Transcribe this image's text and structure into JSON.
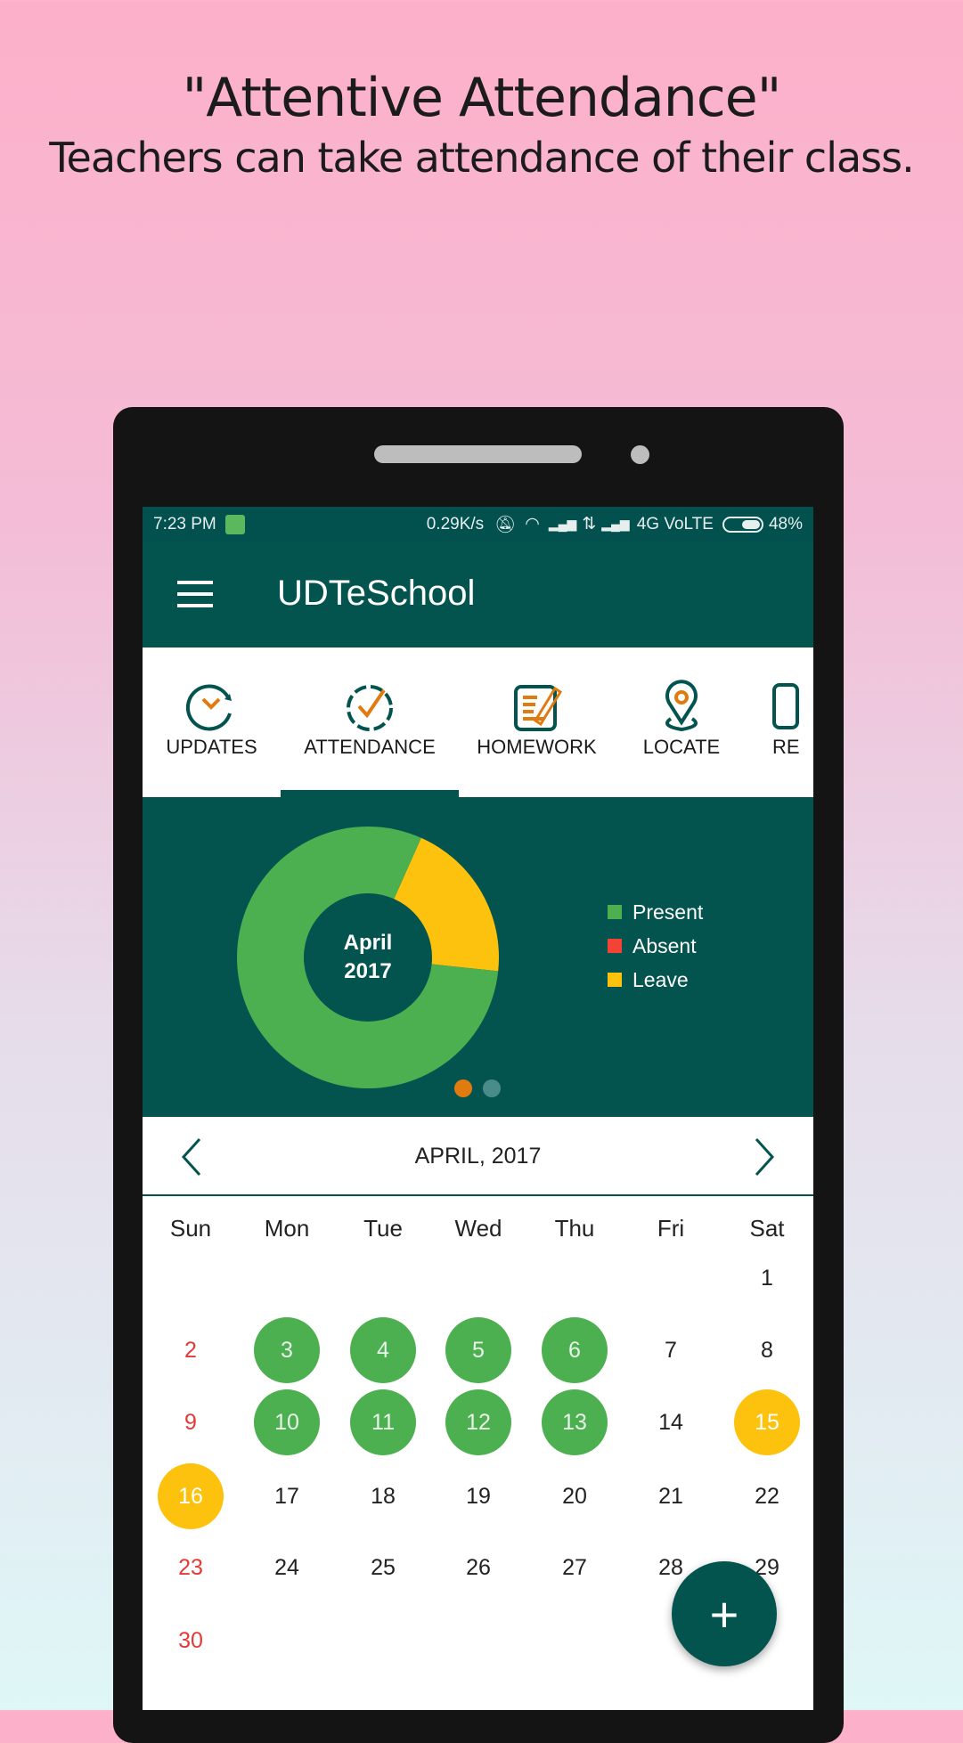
{
  "promo": {
    "headline": "\"Attentive Attendance\"",
    "subline": "Teachers can take attendance of their class."
  },
  "status_bar": {
    "time": "7:23 PM",
    "speed": "0.29K/s",
    "network": "4G VoLTE",
    "battery": "48%",
    "battery_level": 0.48
  },
  "app_bar": {
    "title": "UDTeSchool",
    "menu_icon": "hamburger-icon"
  },
  "tabs": [
    {
      "label": "UPDATES",
      "icon": "clock-refresh-icon"
    },
    {
      "label": "ATTENDANCE",
      "icon": "clock-check-icon",
      "active": true
    },
    {
      "label": "HOMEWORK",
      "icon": "notepad-pencil-icon"
    },
    {
      "label": "LOCATE",
      "icon": "location-pin-icon"
    },
    {
      "label": "RE",
      "icon": "partial-icon"
    }
  ],
  "chart_data": {
    "type": "pie",
    "donut": true,
    "center_label": [
      "April",
      "2017"
    ],
    "series": [
      {
        "name": "Present",
        "value": 8,
        "color": "#4caf50"
      },
      {
        "name": "Absent",
        "value": 0,
        "color": "#f44336"
      },
      {
        "name": "Leave",
        "value": 2,
        "color": "#fdc20d"
      }
    ],
    "legend_position": "right"
  },
  "pager": {
    "count": 2,
    "active": 0,
    "active_color": "#e07b10",
    "inactive_color": "#4a8c8a"
  },
  "calendar": {
    "month_label": "APRIL, 2017",
    "weekdays": [
      "Sun",
      "Mon",
      "Tue",
      "Wed",
      "Thu",
      "Fri",
      "Sat"
    ],
    "first_weekday": 6,
    "days_in_month": 30,
    "present_days": [
      3,
      4,
      5,
      6,
      10,
      11,
      12,
      13
    ],
    "leave_days": [
      15,
      16
    ]
  },
  "colors": {
    "primary": "#03544f",
    "present": "#4caf50",
    "leave": "#fdc20d",
    "absent": "#f44336",
    "accent": "#e07b10"
  },
  "fab": {
    "label": "+"
  }
}
